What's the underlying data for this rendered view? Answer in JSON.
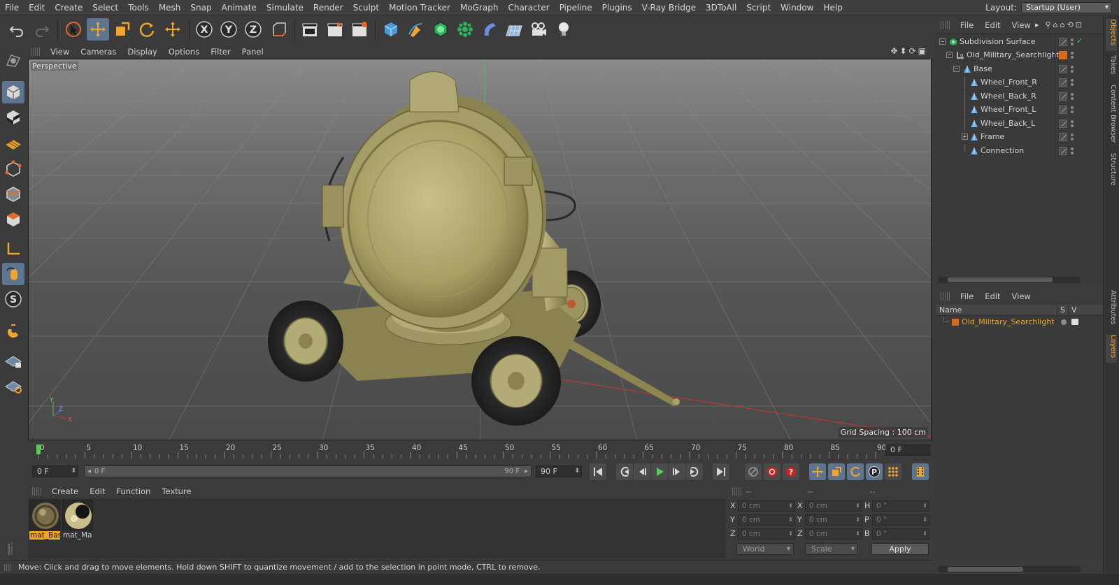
{
  "menubar": {
    "items": [
      "File",
      "Edit",
      "Create",
      "Select",
      "Tools",
      "Mesh",
      "Snap",
      "Animate",
      "Simulate",
      "Render",
      "Sculpt",
      "Motion Tracker",
      "MoGraph",
      "Character",
      "Pipeline",
      "Plugins",
      "V-Ray Bridge",
      "3DToAll",
      "Script",
      "Window",
      "Help"
    ],
    "layout_label": "Layout:",
    "layout_value": "Startup (User)"
  },
  "viewport": {
    "menu": [
      "View",
      "Cameras",
      "Display",
      "Options",
      "Filter",
      "Panel"
    ],
    "camera_label": "Perspective",
    "grid_spacing": "Grid Spacing : 100 cm",
    "axis_x": "X",
    "axis_y": "Y",
    "axis_z": "Z"
  },
  "timeline": {
    "ticks": [
      "0",
      "5",
      "10",
      "15",
      "20",
      "25",
      "30",
      "35",
      "40",
      "45",
      "50",
      "55",
      "60",
      "65",
      "70",
      "75",
      "80",
      "85",
      "90"
    ],
    "current_frame": "0 F"
  },
  "transport": {
    "start_frame": "0 F",
    "range_left": "0 F",
    "range_right": "90 F",
    "end_frame": "90 F"
  },
  "materials": {
    "menu": [
      "Create",
      "Edit",
      "Function",
      "Texture"
    ],
    "items": [
      {
        "name": "mat_Bas",
        "selected": true
      },
      {
        "name": "mat_Ma",
        "selected": false
      }
    ]
  },
  "coordinates": {
    "headers": [
      "--",
      "--",
      "--"
    ],
    "rows": [
      {
        "l1": "X",
        "v1": "0 cm",
        "l2": "X",
        "v2": "0 cm",
        "l3": "H",
        "v3": "0 °"
      },
      {
        "l1": "Y",
        "v1": "0 cm",
        "l2": "Y",
        "v2": "0 cm",
        "l3": "P",
        "v3": "0 °"
      },
      {
        "l1": "Z",
        "v1": "0 cm",
        "l2": "Z",
        "v2": "0 cm",
        "l3": "B",
        "v3": "0 °"
      }
    ],
    "space": "World",
    "mode": "Scale",
    "apply": "Apply"
  },
  "status": {
    "text": "Move: Click and drag to move elements. Hold down SHIFT to quantize movement / add to the selection in point mode, CTRL to remove."
  },
  "objects": {
    "menu": [
      "File",
      "Edit",
      "View"
    ],
    "items": [
      {
        "name": "Subdivision Surface",
        "depth": 0,
        "icon": "subdivision-icon"
      },
      {
        "name": "Old_Military_Searchlight",
        "depth": 1,
        "icon": "null-object-icon"
      },
      {
        "name": "Base",
        "depth": 2,
        "icon": "polygon-object-icon"
      },
      {
        "name": "Wheel_Front_R",
        "depth": 3,
        "icon": "polygon-object-icon"
      },
      {
        "name": "Wheel_Back_R",
        "depth": 3,
        "icon": "polygon-object-icon"
      },
      {
        "name": "Wheel_Front_L",
        "depth": 3,
        "icon": "polygon-object-icon"
      },
      {
        "name": "Wheel_Back_L",
        "depth": 3,
        "icon": "polygon-object-icon"
      },
      {
        "name": "Frame",
        "depth": 3,
        "icon": "polygon-object-icon"
      },
      {
        "name": "Connection",
        "depth": 3,
        "icon": "polygon-object-icon"
      }
    ]
  },
  "layers": {
    "menu": [
      "File",
      "Edit",
      "View"
    ],
    "col_name": "Name",
    "col_s": "S",
    "col_v": "V",
    "items": [
      {
        "name": "Old_Military_Searchlight",
        "color": "#d86a1b"
      }
    ]
  },
  "side_tabs": [
    "Objects",
    "Takes",
    "Content Browser",
    "Structure",
    "Attributes",
    "Layers"
  ],
  "colors": {
    "accent": "#5e7590",
    "selection": "#f5a623",
    "layer_color": "#d86a1b"
  }
}
